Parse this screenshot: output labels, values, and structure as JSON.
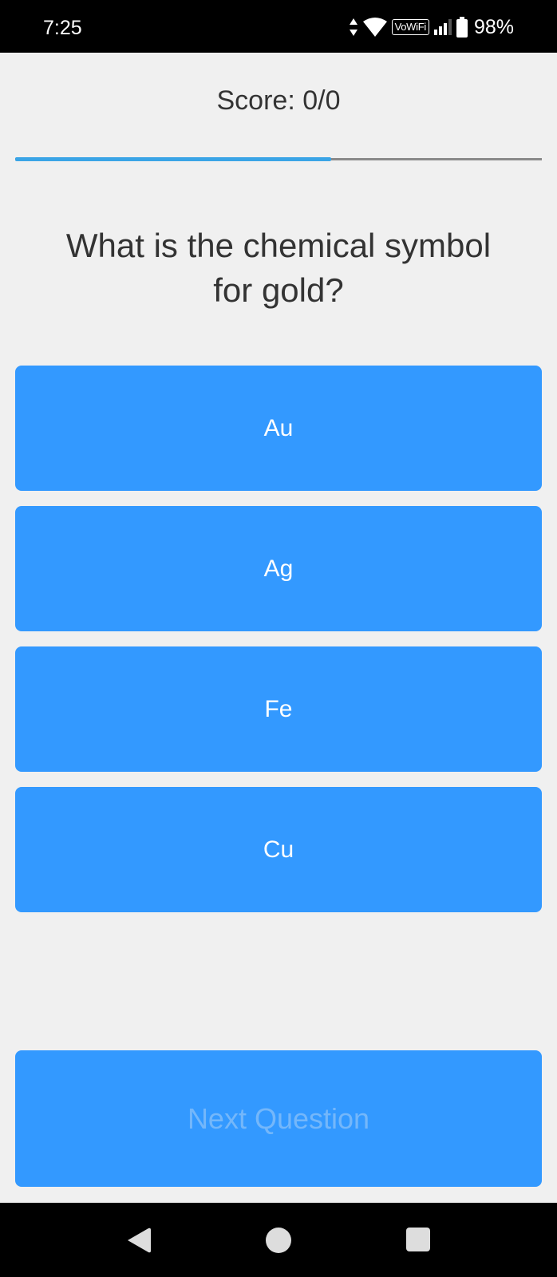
{
  "status_bar": {
    "time": "7:25",
    "vowifi_label": "VoWiFi",
    "battery_percent": "98%",
    "icons": [
      "data-arrows-icon",
      "wifi-icon",
      "signal-icon",
      "battery-icon"
    ]
  },
  "quiz": {
    "score_label": "Score: 0/0",
    "progress_fraction": 0.6,
    "question": "What is the chemical symbol for gold?",
    "answers": [
      "Au",
      "Ag",
      "Fe",
      "Cu"
    ],
    "next_label": "Next Question",
    "next_enabled": false
  },
  "nav_bar": {
    "icons": [
      "back-icon",
      "home-icon",
      "recents-icon"
    ]
  },
  "colors": {
    "background": "#f0f0f0",
    "button": "#3399ff",
    "button_text": "#ffffff",
    "disabled_text": "#74b7fa",
    "progress_fill": "#3aa4e6",
    "progress_track": "#8a8a8a"
  }
}
